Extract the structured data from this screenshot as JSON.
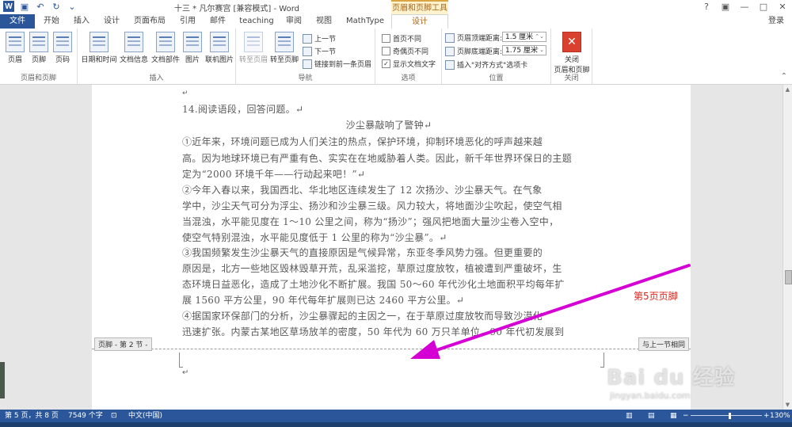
{
  "titlebar": {
    "title": "十三 * 凡尔赛宫 [兼容模式] - Word",
    "context_tab_title": "页眉和页脚工具",
    "controls": [
      "?",
      "▣",
      "—",
      "□",
      "✕"
    ],
    "quick_access": [
      "save-icon",
      "undo-icon",
      "redo-icon",
      "customize-icon"
    ]
  },
  "tabs": {
    "file": "文件",
    "items": [
      "开始",
      "插入",
      "设计",
      "页面布局",
      "引用",
      "邮件",
      "teaching",
      "审阅",
      "视图",
      "MathType",
      "设计"
    ],
    "login": "登录"
  },
  "ribbon": {
    "groups": {
      "header_footer": {
        "label": "页眉和页脚",
        "buttons": [
          "页眉",
          "页脚",
          "页码"
        ]
      },
      "insert": {
        "label": "插入",
        "buttons": [
          "日期和时间",
          "文档信息",
          "文档部件",
          "图片",
          "联机图片"
        ]
      },
      "navigation": {
        "label": "导航",
        "goto_header": "转至页眉",
        "goto_footer": "转至页脚",
        "prev": "上一节",
        "next": "下一节",
        "link_prev": "链接到前一条页眉"
      },
      "options": {
        "label": "选项",
        "first_page": "首页不同",
        "odd_even": "奇偶页不同",
        "show_text": "显示文档文字"
      },
      "position": {
        "label": "位置",
        "header_dist_label": "页眉顶端距离:",
        "header_dist_value": "1.5 厘米",
        "footer_dist_label": "页脚底端距离:",
        "footer_dist_value": "1.75 厘米",
        "insert_tab": "插入\"对齐方式\"选项卡"
      },
      "close": {
        "label": "关闭",
        "button_line1": "关闭",
        "button_line2": "页眉和页脚"
      }
    }
  },
  "document": {
    "heading": "14.阅读语段，回答问题。↵",
    "title": "沙尘暴敲响了警钟↵",
    "lines": [
      "①近年来，环境问题已成为人们关注的热点，保护环境，抑制环境恶化的呼声越来越",
      "高。因为地球环境已有严重有色、实实在在地威胁着人类。因此，新千年世界环保日的主题",
      "定为“2000 环境千年——行动起来吧！”↵",
      "②今年入春以来，我国西北、华北地区连续发生了 12 次扬沙、沙尘暴天气。在气象",
      "学中，沙尘天气可分为浮尘、扬沙和沙尘暴三级。风力较大，将地面沙尘吹起，使空气相",
      "当混浊，水平能见度在 1～10 公里之间，称为“扬沙”；强风把地面大量沙尘卷入空中，",
      "使空气特别混浊，水平能见度低于 1 公里的称为“沙尘暴”。↵",
      "③我国频繁发生沙尘暴天气的直接原因是气候异常，东亚冬季风势力强。但更重要的",
      "原因是，北方一些地区毁林毁草开荒，乱采滥挖，草原过度放牧，植被遭到严重破坏，生",
      "态环境日益恶化，造成了土地沙化不断扩展。我国 50～60 年代沙化土地面积平均每年扩",
      "展 1560 平方公里，90 年代每年扩展则已达 2460 平方公里。↵",
      "④据国家环保部门的分析，沙尘暴骤起的主因之一，在于草原过度放牧而导致沙漠化",
      "迅速扩张。内蒙古某地区草场放羊的密度，50 年代为 60 万只羊单位，90 年代初发展到"
    ],
    "footer_section_label": "页脚 - 第 2 节 -",
    "same_as_prev_label": "与上一节相同",
    "annotation": "第5页页脚",
    "annotation_color": "#e0211b",
    "arrow_color": "#d400d4"
  },
  "statusbar": {
    "page": "第 5 页，共 8 页",
    "words": "7549 个字",
    "lang": "中文(中国)",
    "zoom": "130%",
    "zoom_percent": 130
  },
  "watermark": {
    "brand": "Bai du 经验",
    "url": "jingyan.baidu.com"
  },
  "colors": {
    "accent": "#2b579a",
    "context": "#a5661a"
  }
}
